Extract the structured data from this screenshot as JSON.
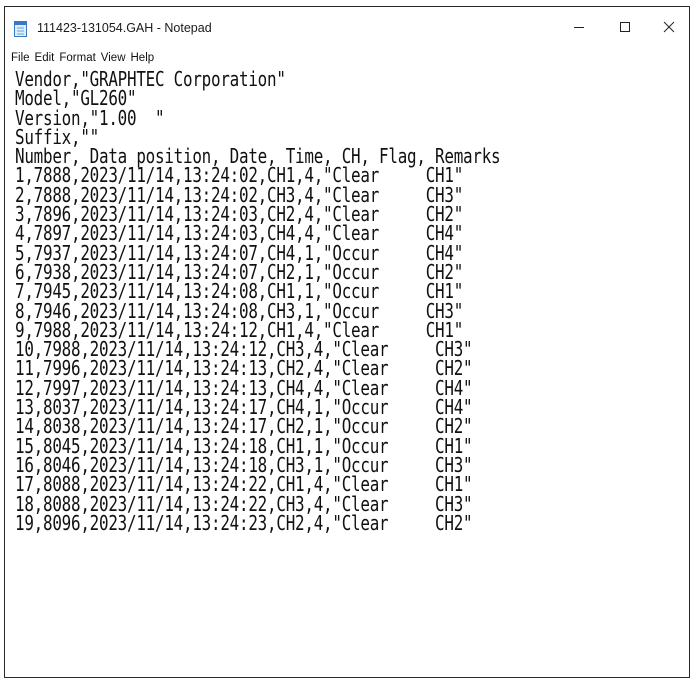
{
  "window": {
    "title": "111423-131054.GAH - Notepad",
    "controls": {
      "minimize": "minimize-icon",
      "maximize": "maximize-icon",
      "close": "close-icon"
    }
  },
  "menu": {
    "items": [
      "File",
      "Edit",
      "Format",
      "View",
      "Help"
    ]
  },
  "editor": {
    "lines": [
      "Vendor,\"GRAPHTEC Corporation\"",
      "Model,\"GL260\"",
      "Version,\"1.00  \"",
      "Suffix,\"\"",
      "Number, Data position, Date, Time, CH, Flag, Remarks",
      "1,7888,2023/11/14,13:24:02,CH1,4,\"Clear     CH1\"",
      "2,7888,2023/11/14,13:24:02,CH3,4,\"Clear     CH3\"",
      "3,7896,2023/11/14,13:24:03,CH2,4,\"Clear     CH2\"",
      "4,7897,2023/11/14,13:24:03,CH4,4,\"Clear     CH4\"",
      "5,7937,2023/11/14,13:24:07,CH4,1,\"Occur     CH4\"",
      "6,7938,2023/11/14,13:24:07,CH2,1,\"Occur     CH2\"",
      "7,7945,2023/11/14,13:24:08,CH1,1,\"Occur     CH1\"",
      "8,7946,2023/11/14,13:24:08,CH3,1,\"Occur     CH3\"",
      "9,7988,2023/11/14,13:24:12,CH1,4,\"Clear     CH1\"",
      "10,7988,2023/11/14,13:24:12,CH3,4,\"Clear     CH3\"",
      "11,7996,2023/11/14,13:24:13,CH2,4,\"Clear     CH2\"",
      "12,7997,2023/11/14,13:24:13,CH4,4,\"Clear     CH4\"",
      "13,8037,2023/11/14,13:24:17,CH4,1,\"Occur     CH4\"",
      "14,8038,2023/11/14,13:24:17,CH2,1,\"Occur     CH2\"",
      "15,8045,2023/11/14,13:24:18,CH1,1,\"Occur     CH1\"",
      "16,8046,2023/11/14,13:24:18,CH3,1,\"Occur     CH3\"",
      "17,8088,2023/11/14,13:24:22,CH1,4,\"Clear     CH1\"",
      "18,8088,2023/11/14,13:24:22,CH3,4,\"Clear     CH3\"",
      "19,8096,2023/11/14,13:24:23,CH2,4,\"Clear     CH2\""
    ]
  }
}
